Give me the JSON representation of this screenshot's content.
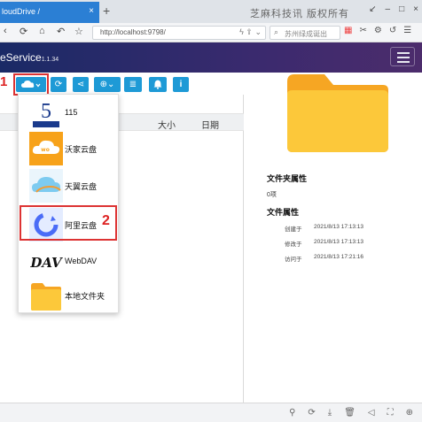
{
  "browser": {
    "tab_title": "loudDrive /",
    "tab_close": "×",
    "new_tab": "+",
    "window_title": "芝麻科技讯 版权所有",
    "address": "http://localhost:9798/",
    "search_placeholder": "苏州绿成诞出",
    "window_controls": [
      "↙",
      "–",
      "□",
      "×"
    ]
  },
  "app": {
    "title": "eService",
    "version": "1.1.34"
  },
  "toolbar_buttons": [
    "cloud",
    "refresh",
    "share",
    "zoom",
    "list",
    "bell",
    "info"
  ],
  "file_table": {
    "col_size": "大小",
    "col_date": "日期",
    "path": "/"
  },
  "cloud_menu": {
    "items": [
      {
        "label": "115",
        "icon": "115-logo-icon"
      },
      {
        "label": "沃家云盘",
        "icon": "wo-cloud-icon"
      },
      {
        "label": "天翼云盘",
        "icon": "tianyi-cloud-icon"
      },
      {
        "label": "阿里云盘",
        "icon": "aliyun-drive-icon"
      },
      {
        "label": "WebDAV",
        "icon": "webdav-logo-icon"
      },
      {
        "label": "本地文件夹",
        "icon": "local-folder-icon"
      }
    ]
  },
  "annotations": {
    "marker1": "1",
    "marker2": "2"
  },
  "details": {
    "folder_props_heading": "文件夹属性",
    "item_count": "0项",
    "file_props_heading": "文件属性",
    "created_label": "创建于",
    "created_value": "2021/8/13 17:13:13",
    "modified_label": "修改于",
    "modified_value": "2021/8/13 17:13:13",
    "accessed_label": "访问于",
    "accessed_value": "2021/8/13 17:21:16"
  },
  "colors": {
    "tab": "#2b7fd4",
    "header": "#1a2a66",
    "button": "#1e9ad6",
    "folder": "#fbc02d",
    "marker": "#d22222"
  }
}
